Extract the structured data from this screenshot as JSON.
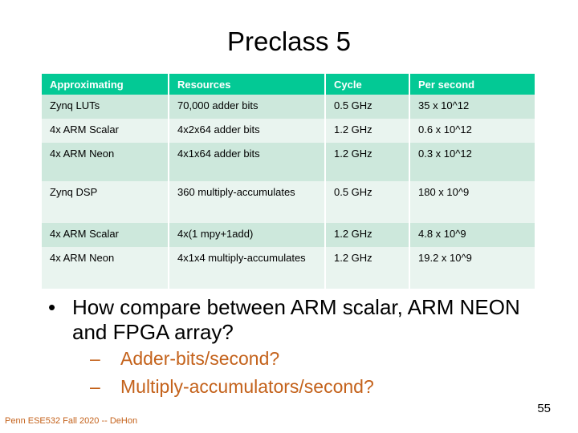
{
  "slide": {
    "title": "Preclass 5",
    "page_number": "55",
    "footer": "Penn ESE532 Fall 2020 -- DeHon"
  },
  "colors": {
    "header_green": "#03C995",
    "row_dark": "#CDE8DC",
    "row_light": "#E9F4EF",
    "accent_orange": "#C4621B",
    "text_black": "#000000",
    "header_text": "#FFFFFF"
  },
  "table": {
    "headers": [
      "Approximating",
      "Resources",
      "Cycle",
      "Per second"
    ],
    "rows": [
      {
        "approximating": "Zynq LUTs",
        "resources": "70,000 adder bits",
        "cycle": "0.5 GHz",
        "per_second": "35 x 10^12"
      },
      {
        "approximating": "4x ARM Scalar",
        "resources": "4x2x64 adder bits",
        "cycle": "1.2 GHz",
        "per_second": "0.6 x 10^12"
      },
      {
        "approximating": "4x ARM Neon",
        "resources": "4x1x64 adder bits",
        "cycle": "1.2 GHz",
        "per_second": "0.3 x 10^12"
      },
      {
        "approximating": "Zynq DSP",
        "resources": "360 multiply-accumulates",
        "cycle": "0.5 GHz",
        "per_second": "180 x 10^9"
      },
      {
        "approximating": "4x ARM Scalar",
        "resources": "4x(1 mpy+1add)",
        "cycle": "1.2 GHz",
        "per_second": "4.8 x 10^9"
      },
      {
        "approximating": "4x ARM Neon",
        "resources": "4x1x4 multiply-accumulates",
        "cycle": "1.2 GHz",
        "per_second": "19.2 x 10^9"
      }
    ]
  },
  "bullets": {
    "main": {
      "marker": "•",
      "text": "How compare between ARM scalar, ARM NEON and FPGA array?"
    },
    "sub": [
      {
        "marker": "–",
        "text": "Adder-bits/second?"
      },
      {
        "marker": "–",
        "text": "Multiply-accumulators/second?"
      }
    ]
  }
}
